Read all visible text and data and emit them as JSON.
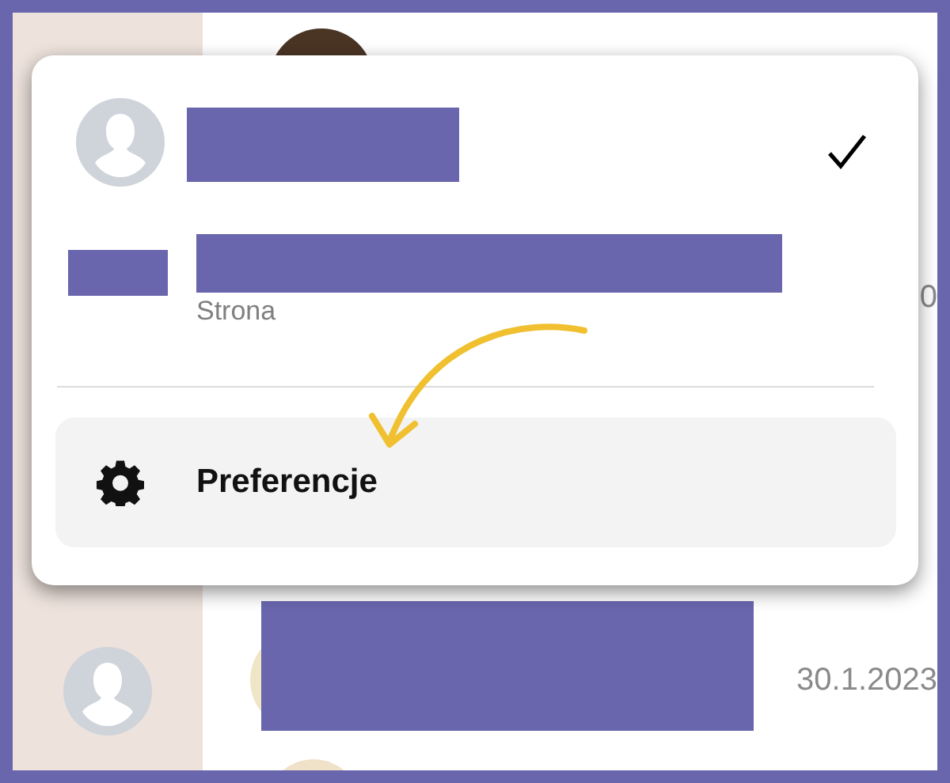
{
  "conversations": [
    {
      "date": "0"
    },
    {
      "date": "30.1.2023"
    }
  ],
  "menu": {
    "items": [
      {
        "kind": "account",
        "selected": true
      },
      {
        "kind": "page",
        "selected": false,
        "subtitle": "Strona"
      }
    ],
    "preferences": {
      "label": "Preferencje"
    }
  }
}
